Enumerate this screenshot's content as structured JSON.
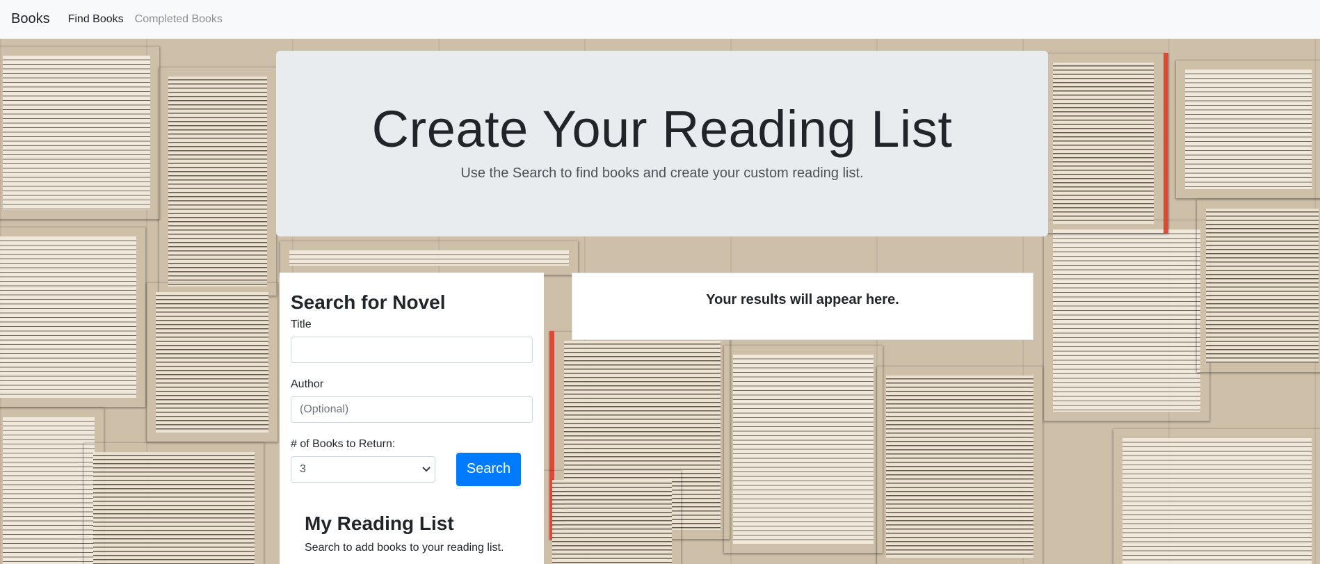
{
  "navbar": {
    "brand": "Books",
    "links": [
      {
        "label": "Find Books"
      },
      {
        "label": "Completed Books"
      }
    ]
  },
  "jumbotron": {
    "title": "Create Your Reading List",
    "subtitle": "Use the Search to find books and create your custom reading list."
  },
  "search": {
    "heading": "Search for Novel",
    "title_label": "Title",
    "title_value": "",
    "author_label": "Author",
    "author_placeholder": "(Optional)",
    "count_label": "# of Books to Return:",
    "count_selected": "3",
    "button_label": "Search"
  },
  "reading_list": {
    "heading": "My Reading List",
    "empty_text": "Search to add books to your reading list."
  },
  "results": {
    "message": "Your results will appear here."
  },
  "colors": {
    "primary": "#007bff",
    "navbar_bg": "#f8f9fa",
    "jumbotron_bg": "#e9ecef"
  },
  "icons": {
    "select_chevron": "chevron-down-icon"
  }
}
